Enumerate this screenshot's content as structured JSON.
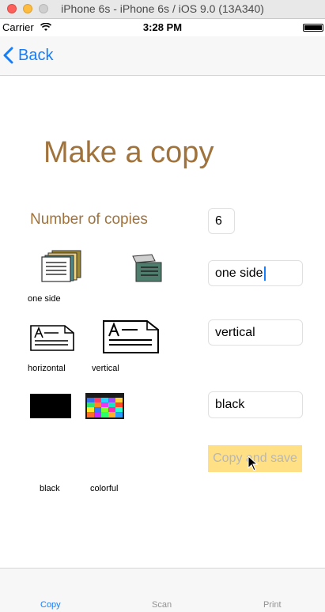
{
  "window": {
    "title": "iPhone 6s - iPhone 6s / iOS 9.0 (13A340)"
  },
  "status": {
    "carrier": "Carrier",
    "time": "3:28 PM"
  },
  "nav": {
    "back_label": "Back"
  },
  "main": {
    "title": "Make a copy",
    "copies_label": "Number of copies",
    "copies_value": "6",
    "sides_value": "one side",
    "orientation_value": "vertical",
    "color_value": "black",
    "copy_save_label": "Copy and save",
    "labels": {
      "one_side": "one side",
      "horizontal": "horizontal",
      "vertical": "vertical",
      "black": "black",
      "colorful": "colorful"
    }
  },
  "tabs": [
    {
      "label": "Copy",
      "active": true
    },
    {
      "label": "Scan",
      "active": false
    },
    {
      "label": "Print",
      "active": false
    }
  ],
  "colors": {
    "accent": "#147efb",
    "title": "#a0733d",
    "button_bg": "#ffe085"
  }
}
